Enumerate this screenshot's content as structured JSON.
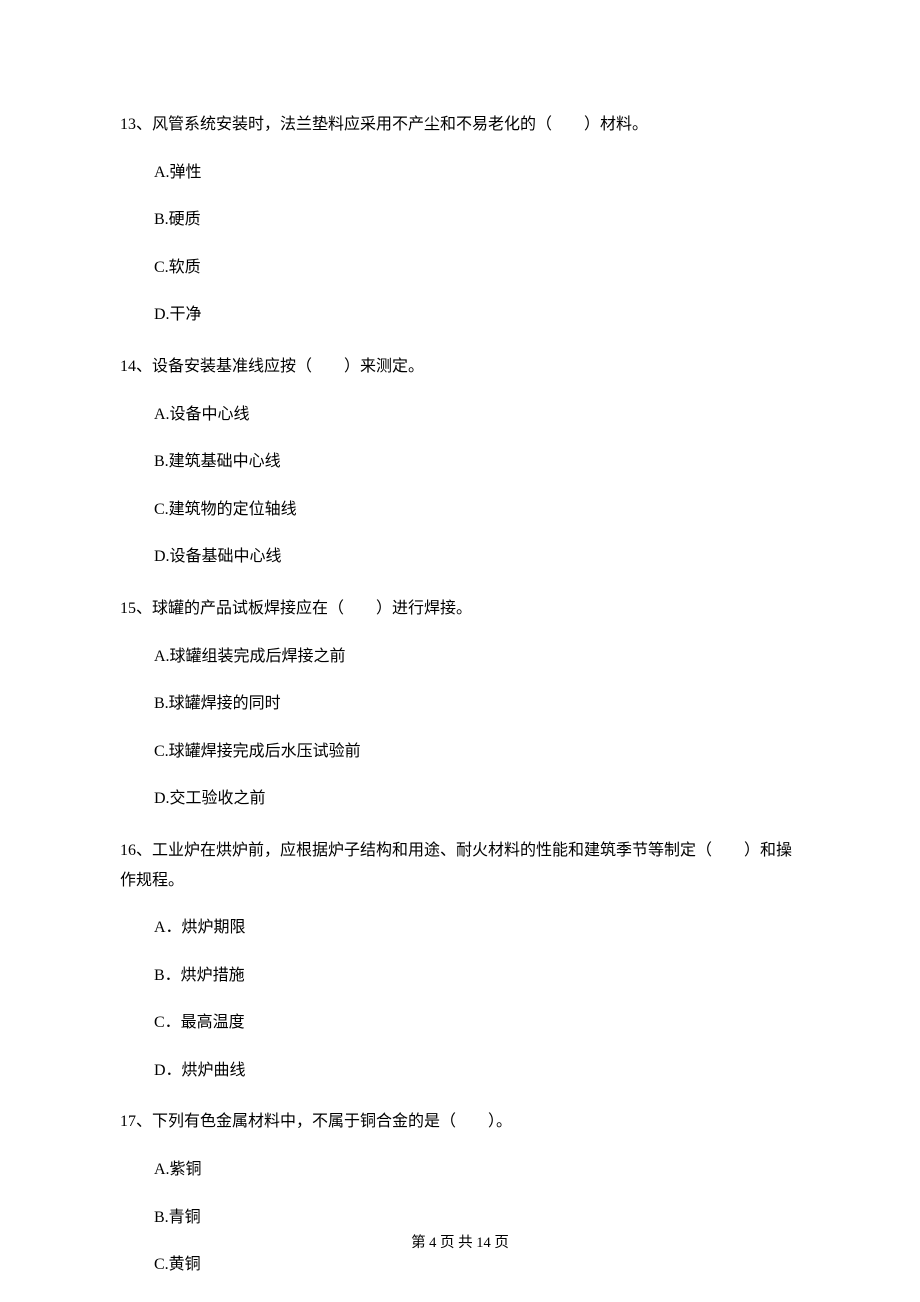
{
  "questions": [
    {
      "number": "13、",
      "text": "风管系统安装时，法兰垫料应采用不产尘和不易老化的（　　）材料。",
      "options": [
        "A.弹性",
        "B.硬质",
        "C.软质",
        "D.干净"
      ]
    },
    {
      "number": "14、",
      "text": "设备安装基准线应按（　　）来测定。",
      "options": [
        "A.设备中心线",
        "B.建筑基础中心线",
        "C.建筑物的定位轴线",
        "D.设备基础中心线"
      ]
    },
    {
      "number": "15、",
      "text": "球罐的产品试板焊接应在（　　）进行焊接。",
      "options": [
        "A.球罐组装完成后焊接之前",
        "B.球罐焊接的同时",
        "C.球罐焊接完成后水压试验前",
        "D.交工验收之前"
      ]
    },
    {
      "number": "16、",
      "text": "工业炉在烘炉前，应根据炉子结构和用途、耐火材料的性能和建筑季节等制定（　　）和操作规程。",
      "options": [
        "A．烘炉期限",
        "B．烘炉措施",
        "C．最高温度",
        "D．烘炉曲线"
      ]
    },
    {
      "number": "17、",
      "text": "下列有色金属材料中，不属于铜合金的是（　　）。",
      "options": [
        "A.紫铜",
        "B.青铜",
        "C.黄铜"
      ]
    }
  ],
  "footer": "第 4 页 共 14 页"
}
